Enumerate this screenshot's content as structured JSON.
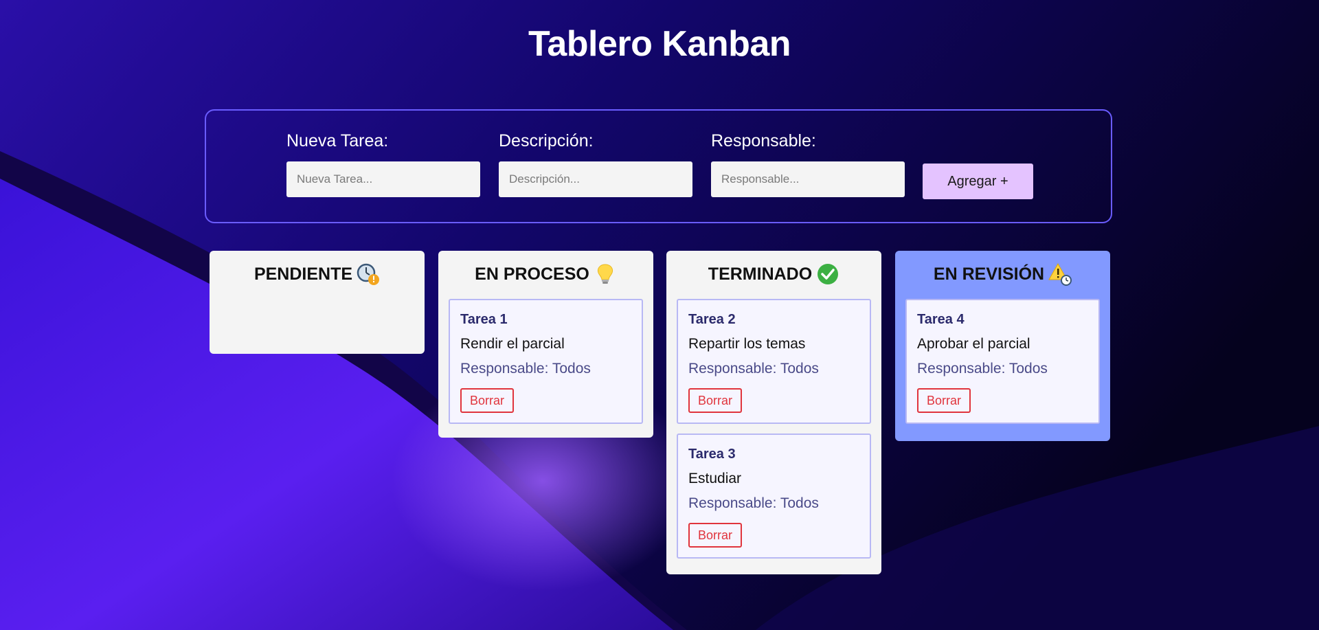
{
  "app": {
    "title": "Tablero Kanban"
  },
  "form": {
    "task_label": "Nueva Tarea:",
    "task_placeholder": "Nueva Tarea...",
    "description_label": "Descripción:",
    "description_placeholder": "Descripción...",
    "owner_label": "Responsable:",
    "owner_placeholder": "Responsable...",
    "add_button": "Agregar +"
  },
  "columns": [
    {
      "title": "PENDIENTE",
      "icon": "clock-warning-icon",
      "cards": []
    },
    {
      "title": "EN PROCESO",
      "icon": "lightbulb-icon",
      "cards": [
        {
          "title": "Tarea 1",
          "description": "Rendir el parcial",
          "owner": "Responsable: Todos",
          "delete_label": "Borrar"
        }
      ]
    },
    {
      "title": "TERMINADO",
      "icon": "check-circle-icon",
      "cards": [
        {
          "title": "Tarea 2",
          "description": "Repartir los temas",
          "owner": "Responsable: Todos",
          "delete_label": "Borrar"
        },
        {
          "title": "Tarea 3",
          "description": "Estudiar",
          "owner": "Responsable: Todos",
          "delete_label": "Borrar"
        }
      ]
    },
    {
      "title": "EN REVISIÓN",
      "icon": "warning-clock-icon",
      "cards": [
        {
          "title": "Tarea 4",
          "description": "Aprobar el parcial",
          "owner": "Responsable: Todos",
          "delete_label": "Borrar"
        }
      ]
    }
  ],
  "colors": {
    "accent_border": "#6a5cff",
    "add_button_bg": "#e4c3ff",
    "column_bg": "#f4f4f4",
    "review_column_bg": "#8299ff",
    "card_bg": "#f6f5ff",
    "card_border": "#b8b8f4",
    "delete_red": "#e0343c"
  }
}
